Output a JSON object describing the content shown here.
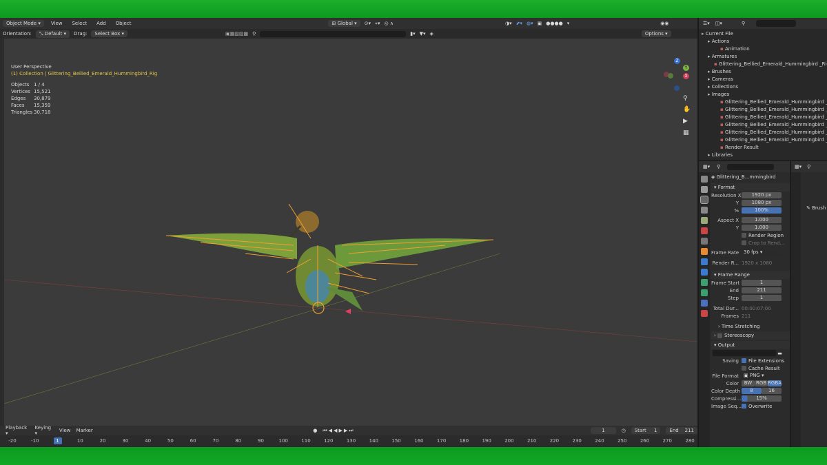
{
  "header": {
    "mode": "Object Mode",
    "menus": [
      "View",
      "Select",
      "Add",
      "Object"
    ],
    "transform": "Global",
    "options": "Options"
  },
  "subheader": {
    "orientation_label": "Orientation:",
    "orientation_value": "Default",
    "drag_label": "Drag:",
    "drag_value": "Select Box"
  },
  "viewport": {
    "perspective": "User Perspective",
    "collection": "(1) Collection | Glittering_Bellied_Emerald_Hummingbird_Rig",
    "stats": [
      {
        "k": "Objects",
        "v": "1 / 4"
      },
      {
        "k": "Vertices",
        "v": "15,521"
      },
      {
        "k": "Edges",
        "v": "30,879"
      },
      {
        "k": "Faces",
        "v": "15,359"
      },
      {
        "k": "Triangles",
        "v": "30,718"
      }
    ],
    "gizmo": {
      "z": "Z",
      "y": "Y",
      "x": "X"
    }
  },
  "outliner": {
    "items": [
      {
        "label": "Current File",
        "indent": 0
      },
      {
        "label": "Actions",
        "indent": 1
      },
      {
        "label": "Animation",
        "indent": 3
      },
      {
        "label": "Armatures",
        "indent": 1
      },
      {
        "label": "Glittering_Bellied_Emerald_Hummingbird _Rig",
        "indent": 2
      },
      {
        "label": "Brushes",
        "indent": 1
      },
      {
        "label": "Cameras",
        "indent": 1
      },
      {
        "label": "Collections",
        "indent": 1
      },
      {
        "label": "Images",
        "indent": 1
      },
      {
        "label": "Glittering_Bellied_Emerald_Hummingbird _AO.p",
        "indent": 3
      },
      {
        "label": "Glittering_Bellied_Emerald_Hummingbird _Diffus",
        "indent": 3
      },
      {
        "label": "Glittering_Bellied_Emerald_Hummingbird _Meta",
        "indent": 3
      },
      {
        "label": "Glittering_Bellied_Emerald_Hummingbird _Meta",
        "indent": 3
      },
      {
        "label": "Glittering_Bellied_Emerald_Hummingbird _Norm",
        "indent": 3
      },
      {
        "label": "Glittering_Bellied_Emerald_Hummingbird _Spec",
        "indent": 3
      },
      {
        "label": "Render Result",
        "indent": 3
      },
      {
        "label": "Libraries",
        "indent": 1
      }
    ]
  },
  "properties": {
    "scene_name": "Glittering_B...mmingbird",
    "format": "Format",
    "res_x_label": "Resolution X",
    "res_x": "1920 px",
    "res_y_label": "Y",
    "res_y": "1080 px",
    "pct_label": "%",
    "pct": "100%",
    "aspect_x_label": "Aspect X",
    "aspect_x": "1.000",
    "aspect_y_label": "Y",
    "aspect_y": "1.000",
    "render_region": "Render Region",
    "crop": "Crop to Rend...",
    "frame_rate_label": "Frame Rate",
    "frame_rate": "30 fps",
    "render_r_label": "Render R...",
    "render_r": "1920 x 1080",
    "frame_range": "Frame Range",
    "frame_start_label": "Frame Start",
    "frame_start": "1",
    "end_label": "End",
    "end": "211",
    "step_label": "Step",
    "step": "1",
    "total_label": "Total Dur...",
    "total": "00:00:07:00",
    "frames_label": "Frames",
    "frames": "211",
    "time_stretching": "Time Stretching",
    "stereoscopy": "Stereoscopy",
    "output": "Output",
    "saving_label": "Saving",
    "file_ext": "File Extensions",
    "cache_result": "Cache Result",
    "file_format_label": "File Format",
    "file_format": "PNG",
    "color_label": "Color",
    "color_bw": "BW",
    "color_rgb": "RGB",
    "color_rgba": "RGBA",
    "depth_label": "Color Depth",
    "depth_8": "8",
    "depth_16": "16",
    "compress_label": "Compressi...",
    "compress": "15%",
    "image_seq_label": "Image Seq...",
    "overwrite": "Overwrite",
    "brush_label": "Brush"
  },
  "timeline": {
    "menus": [
      "Playback",
      "Keying",
      "View",
      "Marker"
    ],
    "current": "1",
    "start_label": "Start",
    "start": "1",
    "end_label": "End",
    "end": "211",
    "ticks": [
      "-20",
      "-10",
      "1",
      "10",
      "20",
      "30",
      "40",
      "50",
      "60",
      "70",
      "80",
      "90",
      "100",
      "110",
      "120",
      "130",
      "140",
      "150",
      "160",
      "170",
      "180",
      "190",
      "200",
      "210",
      "220",
      "230",
      "240",
      "250",
      "260",
      "270",
      "280"
    ]
  }
}
